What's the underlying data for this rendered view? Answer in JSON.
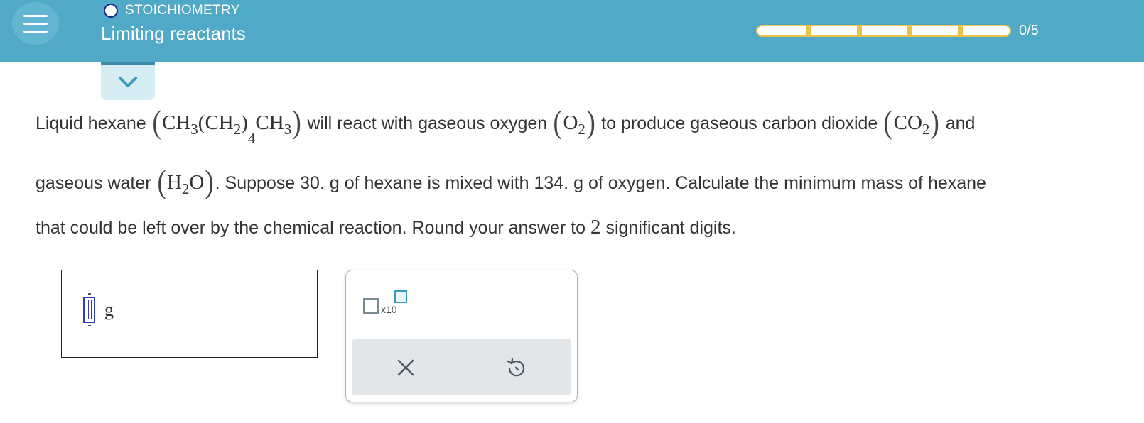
{
  "header": {
    "topic": "STOICHIOMETRY",
    "title": "Limiting reactants",
    "progress": {
      "completed": 0,
      "total": 5,
      "label": "0/5"
    }
  },
  "question": {
    "t1": "Liquid hexane",
    "hexane_formula": [
      "CH",
      "3",
      "(CH",
      "2",
      ")",
      "4",
      "CH",
      "3"
    ],
    "t2": "will react with gaseous oxygen",
    "oxygen_formula": [
      "O",
      "2"
    ],
    "t3": "to produce gaseous carbon dioxide",
    "co2_formula": [
      "CO",
      "2"
    ],
    "t4": "and",
    "t5": "gaseous water",
    "water_formula": [
      "H",
      "2",
      "O"
    ],
    "t6": ". Suppose 30. g of hexane is mixed with 134. g of oxygen. Calculate the minimum mass of hexane",
    "t7": "that could be left over by the chemical reaction. Round your answer to",
    "sig_digits": "2",
    "t8": "significant digits."
  },
  "answer": {
    "unit": "g",
    "value": ""
  },
  "keypad": {
    "x10_label": "x10"
  },
  "icons": {
    "menu": "hamburger-icon",
    "collapse": "chevron-down-icon",
    "clear": "close-icon",
    "undo": "undo-icon"
  },
  "colors": {
    "header": "#4fa9c7",
    "progress": "#e9c24a",
    "cursor": "#2f3fc0",
    "accent": "#3a9bc1"
  }
}
